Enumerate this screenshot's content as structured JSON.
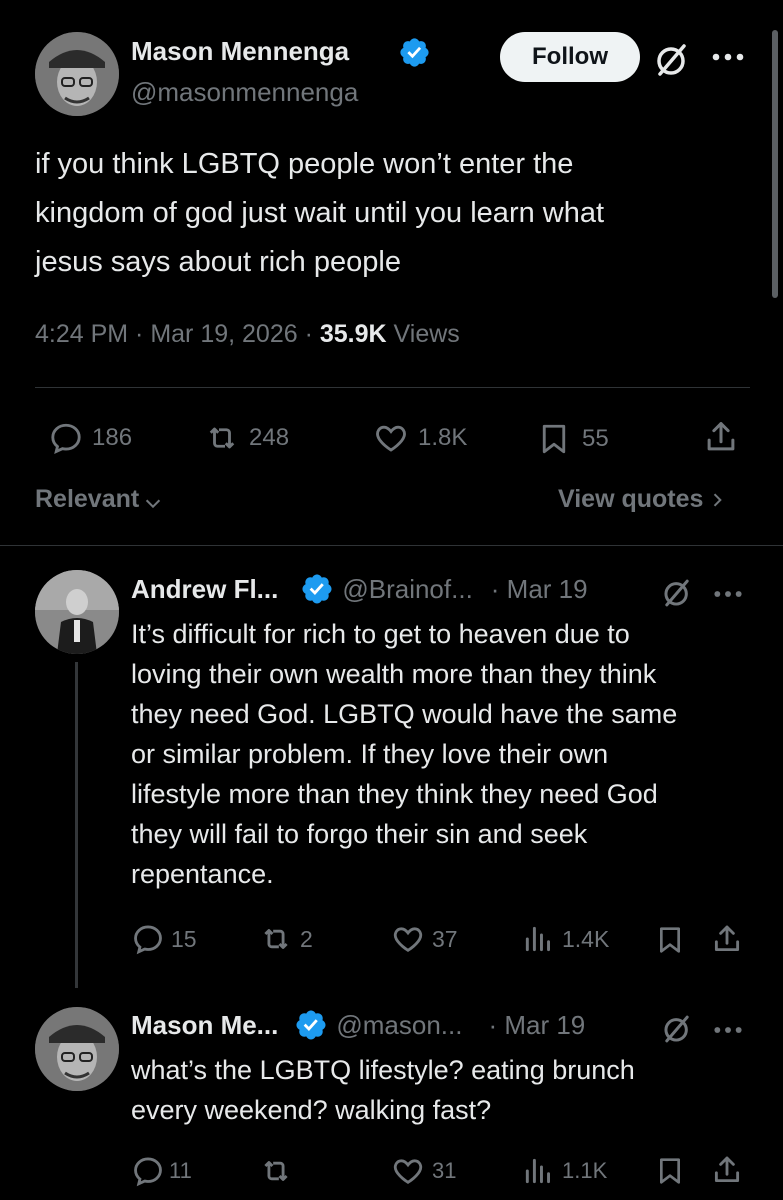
{
  "main_tweet": {
    "author_name": "Mason Mennenga",
    "handle": "@masonmennenga",
    "follow_label": "Follow",
    "text_lines": [
      "if you think LGBTQ people won’t enter the",
      "kingdom of god just wait until you learn what",
      "jesus says about rich people"
    ],
    "time": "4:24 PM",
    "date": "Mar 19, 2026",
    "views_count": "35.9K",
    "views_label": "Views",
    "replies": "186",
    "reposts": "248",
    "likes": "1.8K",
    "bookmarks": "55",
    "sort_label": "Relevant",
    "view_quotes_label": "View quotes"
  },
  "replies": [
    {
      "name": "Andrew Fl...",
      "handle": "@Brainof...",
      "date": "· Mar 19",
      "text_lines": [
        "It’s difficult for rich to get to heaven due to",
        "loving their own wealth more than they think",
        "they need God. LGBTQ would have the same",
        "or similar problem. If they love their own",
        "lifestyle more than they think they need God",
        "they will fail to forgo their sin and seek",
        "repentance."
      ],
      "replies": "15",
      "reposts": "2",
      "likes": "37",
      "views": "1.4K"
    },
    {
      "name": "Mason Me...",
      "handle": "@mason...",
      "date": "· Mar 19",
      "text_lines": [
        "what’s the LGBTQ lifestyle? eating brunch",
        "every weekend? walking fast?"
      ],
      "replies": "11",
      "reposts": "",
      "likes": "31",
      "views": "1.1K"
    }
  ],
  "colors": {
    "background": "#000000",
    "text": "#e7e9ea",
    "muted": "#71767b",
    "verified": "#1d9bf0",
    "divider": "#2f3336"
  },
  "icons": [
    "verified-badge-icon",
    "grok-icon",
    "more-icon",
    "reply-icon",
    "repost-icon",
    "like-icon",
    "bookmark-icon",
    "share-icon",
    "views-icon",
    "chevron-down-icon",
    "chevron-right-icon"
  ]
}
